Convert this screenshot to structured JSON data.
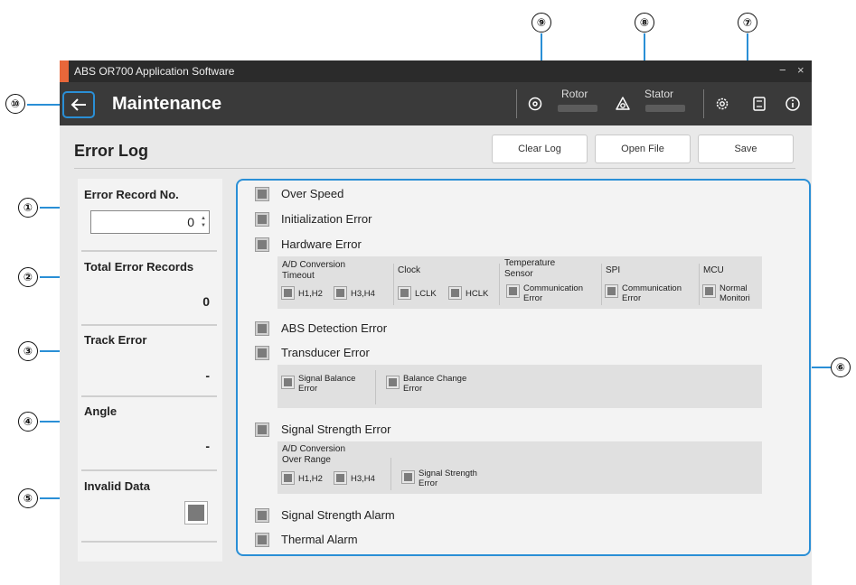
{
  "window": {
    "title": "ABS OR700 Application Software",
    "minimize": "−",
    "close": "×"
  },
  "appbar": {
    "title": "Maintenance",
    "rotor_label": "Rotor",
    "stator_label": "Stator"
  },
  "page": {
    "title": "Error Log"
  },
  "toolbar": {
    "clear_log": "Clear Log",
    "open_file": "Open File",
    "save": "Save"
  },
  "left": {
    "error_record_label": "Error Record No.",
    "error_record_value": "0",
    "total_label": "Total Error Records",
    "total_value": "0",
    "track_label": "Track Error",
    "track_value": "-",
    "angle_label": "Angle",
    "angle_value": "-",
    "invalid_label": "Invalid Data"
  },
  "errors": {
    "over_speed": "Over Speed",
    "init": "Initialization Error",
    "hardware": "Hardware Error",
    "abs_detection": "ABS Detection Error",
    "transducer": "Transducer Error",
    "signal_strength": "Signal Strength Error",
    "signal_alarm": "Signal Strength Alarm",
    "thermal_alarm": "Thermal Alarm"
  },
  "hardware": {
    "ad_timeout_1": "A/D Conversion",
    "ad_timeout_2": "Timeout",
    "h1h2": "H1,H2",
    "h3h4": "H3,H4",
    "clock": "Clock",
    "lclk": "LCLK",
    "hclk": "HCLK",
    "temp_1": "Temperature",
    "temp_2": "Sensor",
    "comm_1": "Communication",
    "comm_2": "Error",
    "spi": "SPI",
    "spi_comm_1": "Communication",
    "spi_comm_2": "Error",
    "mcu": "MCU",
    "mcu_1": "Normal",
    "mcu_2": "Monitori"
  },
  "transducer": {
    "sig_bal_1": "Signal Balance",
    "sig_bal_2": "Error",
    "bal_chg_1": "Balance Change",
    "bal_chg_2": "Error"
  },
  "signal": {
    "ad_1": "A/D Conversion",
    "ad_2": "Over Range",
    "h1h2": "H1,H2",
    "h3h4": "H3,H4",
    "ss_1": "Signal Strength",
    "ss_2": "Error"
  },
  "callouts": [
    "①",
    "②",
    "③",
    "④",
    "⑤",
    "⑥",
    "⑦",
    "⑧",
    "⑨",
    "⑩"
  ],
  "colors": {
    "accent": "#2a8fd6",
    "titlebar_accent": "#e8673a",
    "appbar": "#3a3a3a",
    "indicator": "#7c7c7c"
  },
  "icons": [
    "back-arrow-icon",
    "disc-icon",
    "stator-icon",
    "gear-icon",
    "book-icon",
    "info-icon"
  ]
}
